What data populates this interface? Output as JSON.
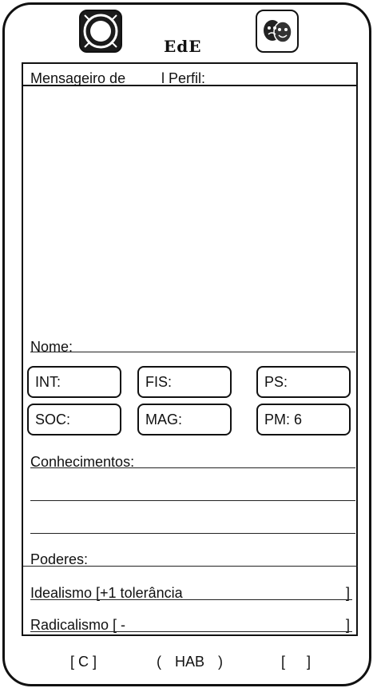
{
  "header": {
    "logo_text": "EdE",
    "left_icon": "circle-ring-icon",
    "right_icon": "theater-masks-icon"
  },
  "card": {
    "header_left": "Mensageiro de",
    "header_right": "l Perfil:",
    "name_label": "Nome:",
    "stats": [
      {
        "label": "INT:"
      },
      {
        "label": "FIS:"
      },
      {
        "label": "PS:"
      },
      {
        "label": "SOC:"
      },
      {
        "label": "MAG:"
      },
      {
        "label": "PM: 6"
      }
    ],
    "knowledge_label": "Conhecimentos:",
    "powers_label": "Poderes:",
    "idealism": {
      "text": "Idealismo [+1 tolerância",
      "close": "]"
    },
    "radicalism": {
      "text": "Radicalismo [ -",
      "close": "]"
    }
  },
  "bottom": {
    "c": "[ C ]",
    "hab": "( HAB )",
    "blank": "[ ]"
  }
}
